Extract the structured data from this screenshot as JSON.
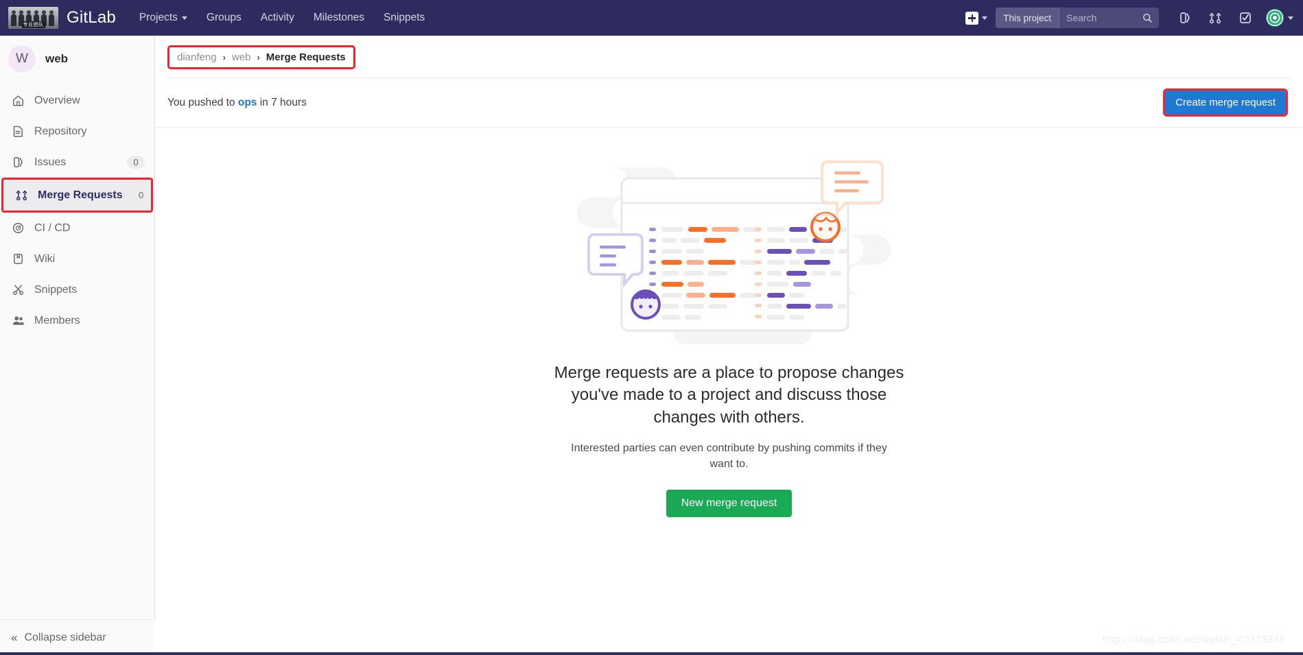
{
  "navbar": {
    "brand": "GitLab",
    "logo_caption": "专业团队",
    "links": [
      {
        "label": "Projects",
        "has_caret": true
      },
      {
        "label": "Groups",
        "has_caret": false
      },
      {
        "label": "Activity",
        "has_caret": false
      },
      {
        "label": "Milestones",
        "has_caret": false
      },
      {
        "label": "Snippets",
        "has_caret": false
      }
    ],
    "search": {
      "scope": "This project",
      "placeholder": "Search",
      "value": ""
    },
    "icons": [
      "plus-icon",
      "issues-icon",
      "merge-requests-icon",
      "todos-icon"
    ]
  },
  "sidebar": {
    "project": {
      "initial": "W",
      "name": "web"
    },
    "items": [
      {
        "label": "Overview",
        "icon": "home-icon",
        "badge": "",
        "active": false
      },
      {
        "label": "Repository",
        "icon": "document-icon",
        "badge": "",
        "active": false
      },
      {
        "label": "Issues",
        "icon": "issues-icon",
        "badge": "0",
        "active": false
      },
      {
        "label": "Merge Requests",
        "icon": "merge-requests-icon",
        "badge": "0",
        "active": true
      },
      {
        "label": "CI / CD",
        "icon": "rocket-icon",
        "badge": "",
        "active": false
      },
      {
        "label": "Wiki",
        "icon": "book-icon",
        "badge": "",
        "active": false
      },
      {
        "label": "Snippets",
        "icon": "scissors-icon",
        "badge": "",
        "active": false
      },
      {
        "label": "Members",
        "icon": "users-icon",
        "badge": "",
        "active": false
      }
    ],
    "collapse_label": "Collapse sidebar"
  },
  "breadcrumb": {
    "group": "dianfeng",
    "project": "web",
    "separator": "›",
    "current": "Merge Requests"
  },
  "push_notice": {
    "prefix": "You pushed to",
    "branch": "ops",
    "suffix": "in 7 hours",
    "create_button": "Create merge request"
  },
  "empty_state": {
    "title": "Merge requests are a place to propose changes you've made to a project and discuss those changes with others.",
    "subtitle": "Interested parties can even contribute by pushing commits if they want to.",
    "button": "New merge request"
  },
  "watermark": "https://blog.csdn.net/weixin_45373345",
  "colors": {
    "navbar_bg": "#2e2b5f",
    "annotation_red": "#f5222d",
    "primary_blue": "#1f78d1",
    "link_blue": "#1f75cb",
    "success_green": "#1aaa55",
    "sidebar_bg": "#fafafa",
    "active_item_bg": "#ececef"
  }
}
